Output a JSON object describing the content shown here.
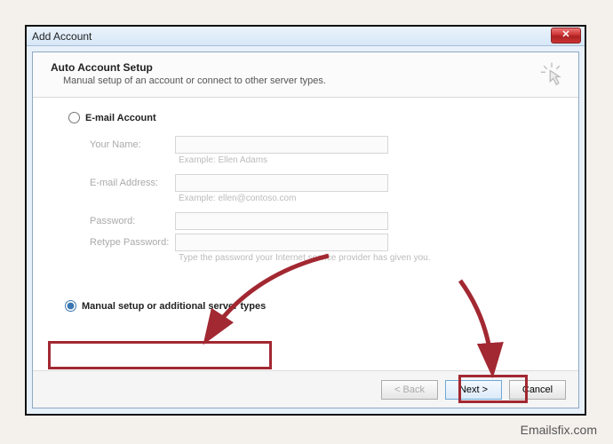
{
  "window": {
    "title": "Add Account",
    "close_glyph": "✕"
  },
  "header": {
    "title": "Auto Account Setup",
    "subtitle": "Manual setup of an account or connect to other server types."
  },
  "options": {
    "email_account": "E-mail Account",
    "manual_setup": "Manual setup or additional server types"
  },
  "fields": {
    "name_label": "Your Name:",
    "name_example": "Example: Ellen Adams",
    "email_label": "E-mail Address:",
    "email_example": "Example: ellen@contoso.com",
    "password_label": "Password:",
    "retype_label": "Retype Password:",
    "password_hint": "Type the password your Internet service provider has given you."
  },
  "buttons": {
    "back": "< Back",
    "next": "Next >",
    "cancel": "Cancel"
  },
  "watermark": "Emailsfix.com",
  "values": {
    "name": "",
    "email": "",
    "password": "",
    "retype": ""
  }
}
